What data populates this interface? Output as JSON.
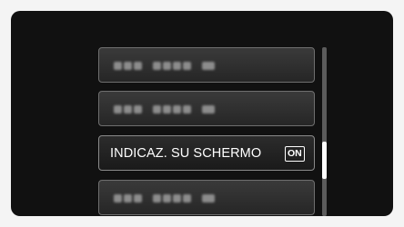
{
  "menu": {
    "items": [
      {
        "state": "blurred"
      },
      {
        "state": "blurred"
      },
      {
        "label": "INDICAZ. SU SCHERMO",
        "value_badge": "ON",
        "state": "selected"
      },
      {
        "state": "blurred"
      }
    ]
  },
  "scrollbar": {
    "thumb_position": 0.72,
    "thumb_fraction": 0.22
  },
  "colors": {
    "screen_bg": "#111111",
    "item_border": "#6f6f6f",
    "text": "#ffffff"
  }
}
